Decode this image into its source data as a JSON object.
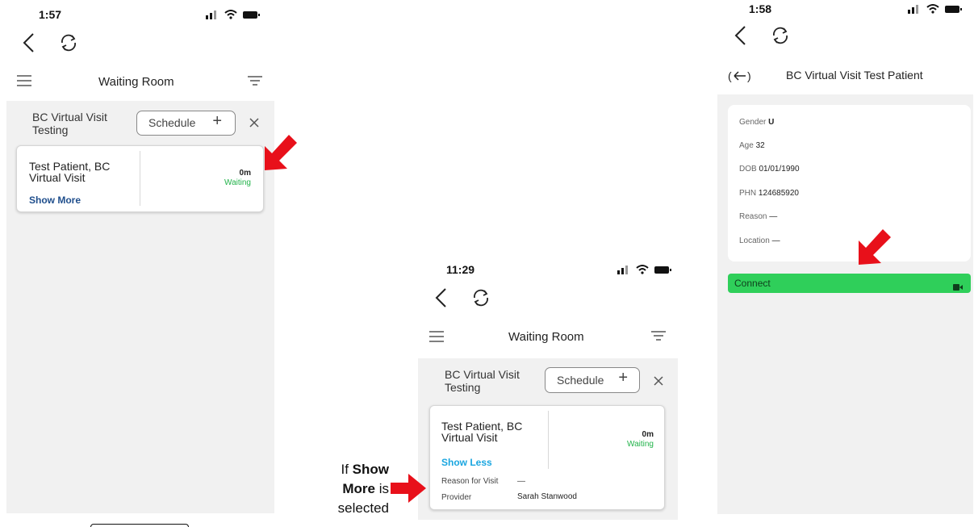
{
  "left": {
    "time": "1:57",
    "title": "Waiting Room",
    "group_name": "BC Virtual Visit Testing",
    "group_line1": "BC Virtual Visit",
    "group_line2": "Testing",
    "schedule_label": "Schedule",
    "patient_line1": "Test Patient, BC",
    "patient_line2": "Virtual Visit",
    "duration": "0m",
    "status": "Waiting",
    "toggle_label": "Show More"
  },
  "middle": {
    "time": "11:29",
    "title": "Waiting Room",
    "group_line1": "BC Virtual Visit",
    "group_line2": "Testing",
    "schedule_label": "Schedule",
    "patient_line1": "Test Patient, BC",
    "patient_line2": "Virtual Visit",
    "duration": "0m",
    "status": "Waiting",
    "toggle_label": "Show Less",
    "reason_label": "Reason for Visit",
    "reason_value": "—",
    "provider_label": "Provider",
    "provider_value": "Sarah Stanwood"
  },
  "right": {
    "time": "1:58",
    "title": "BC Virtual Visit Test Patient",
    "gender_label": "Gender",
    "gender_value": "U",
    "age_label": "Age",
    "age_value": "32",
    "dob_label": "DOB",
    "dob_value": "01/01/1990",
    "phn_label": "PHN",
    "phn_value": "124685920",
    "reason_label": "Reason",
    "reason_value": "—",
    "location_label": "Location",
    "location_value": "—",
    "connect_label": "Connect"
  },
  "annotation": {
    "if": "If",
    "show": "Show",
    "more": "More",
    "is": "is",
    "selected": "selected"
  },
  "colors": {
    "arrow": "#e8101a",
    "connect": "#2fcf5a",
    "waiting": "#22b34a",
    "show_more": "#1f4e8c",
    "show_less": "#1aa6e0"
  }
}
